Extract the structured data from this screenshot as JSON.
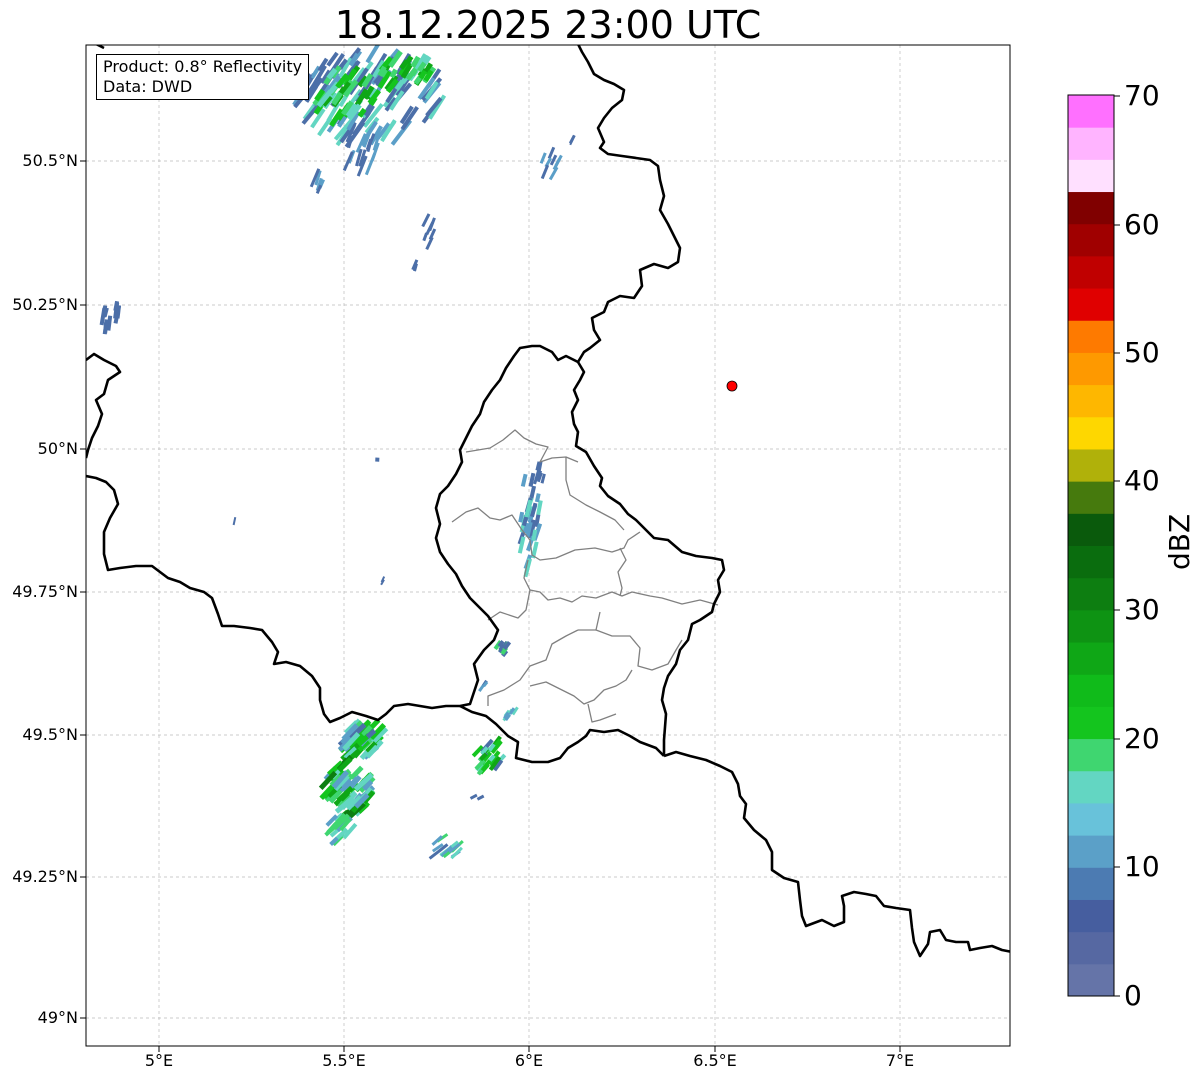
{
  "title": "18.12.2025 23:00 UTC",
  "info_box": {
    "product": "Product: 0.8° Reflectivity",
    "data": "Data: DWD"
  },
  "lat_labels": [
    "50.5°N",
    "50.25°N",
    "50°N",
    "49.75°N",
    "49.5°N",
    "49.25°N",
    "49°N"
  ],
  "lon_labels": [
    "5°E",
    "5.5°E",
    "6°E",
    "6.5°E",
    "7°E"
  ],
  "colorbar": {
    "label": "dBZ",
    "tick_labels": [
      "70",
      "60",
      "50",
      "40",
      "30",
      "20",
      "10",
      "0"
    ],
    "range": [
      0,
      70
    ],
    "step": 2.5,
    "colors": [
      "#6574a8",
      "#5668a2",
      "#465e9f",
      "#4c7bb2",
      "#5ba0c8",
      "#68c2da",
      "#63d6c2",
      "#3fd670",
      "#14c51e",
      "#10bb1a",
      "#0fa716",
      "#0e9313",
      "#0d7e11",
      "#0a6d0e",
      "#0a5a0c",
      "#467a0d",
      "#b0b10a",
      "#fed700",
      "#feb700",
      "#fe9900",
      "#fe7a00",
      "#e00000",
      "#c00000",
      "#a00000",
      "#800000",
      "#ffe0ff",
      "#ffb4ff",
      "#ff70ff",
      "#f03cf0"
    ]
  },
  "marker": {
    "lon": 6.55,
    "lat": 50.11,
    "color": "#ff0000"
  },
  "extent": {
    "lon": [
      4.8,
      7.3
    ],
    "lat": [
      48.95,
      50.7
    ]
  }
}
